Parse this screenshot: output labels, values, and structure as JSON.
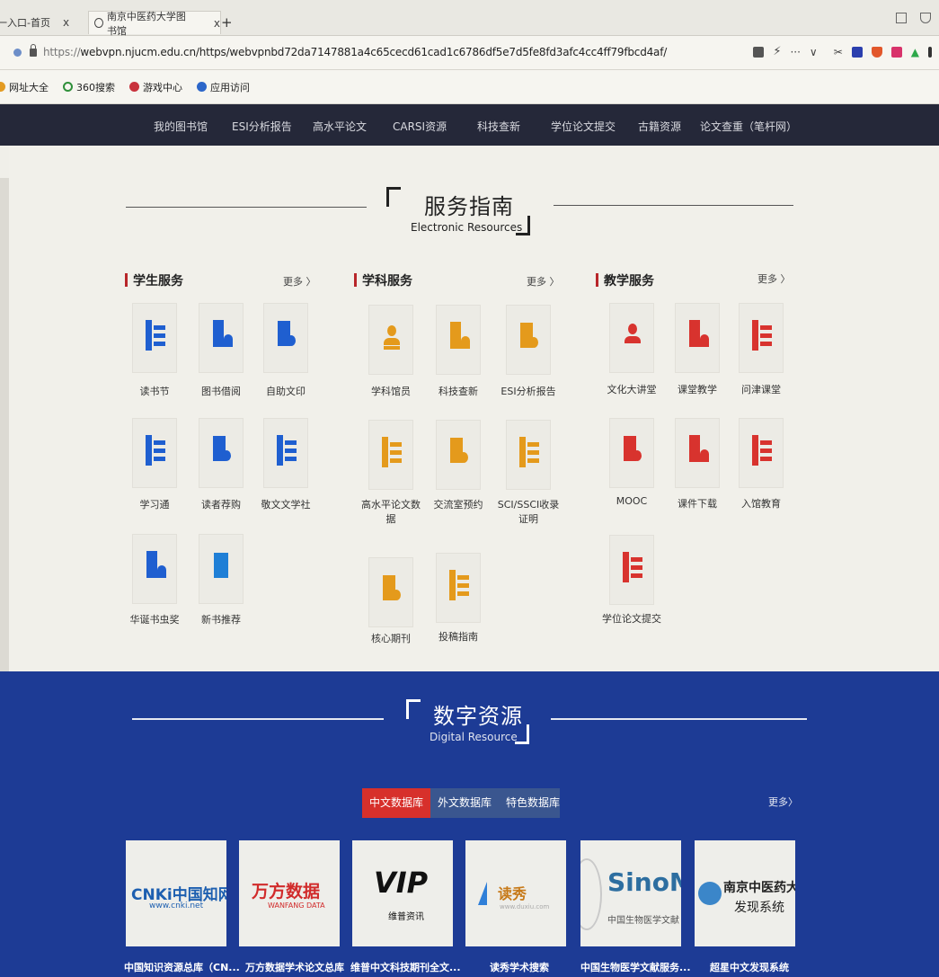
{
  "browser": {
    "tabs": [
      {
        "label": "统一入口-首页",
        "close": "x"
      },
      {
        "label": "南京中医药大学图书馆",
        "close": "x"
      }
    ],
    "new_tab": "+",
    "url_scheme": "https://",
    "url_rest": "webvpn.njucm.edu.cn/https/webvpnbd72da7147881a4c65cecd61cad1c6786df5e7d5fe8fd3afc4cc4ff79fbcd4af/",
    "bookmarks": [
      "网址大全",
      "360搜索",
      "游戏中心",
      "应用访问"
    ]
  },
  "site_nav": [
    "我的图书馆",
    "ESI分析报告",
    "高水平论文",
    "CARSI资源",
    "科技查新",
    "学位论文提交",
    "古籍资源",
    "论文查重（笔杆网）"
  ],
  "service_guide": {
    "title": "服务指南",
    "subtitle": "Electronic Resources",
    "more": "更多 〉",
    "columns": [
      {
        "title": "学生服务",
        "items": [
          "读书节",
          "图书借阅",
          "自助文印",
          "学习通",
          "读者荐购",
          "敬文文学社",
          "华诞书虫奖",
          "新书推荐"
        ]
      },
      {
        "title": "学科服务",
        "items": [
          "学科馆员",
          "科技查新",
          "ESI分析报告",
          "高水平论文数据",
          "交流室预约",
          "SCI/SSCI收录证明",
          "核心期刊",
          "投稿指南"
        ]
      },
      {
        "title": "教学服务",
        "items": [
          "文化大讲堂",
          "课堂教学",
          "问津课堂",
          "MOOC",
          "课件下载",
          "入馆教育",
          "学位论文提交"
        ]
      }
    ]
  },
  "digital": {
    "title": "数字资源",
    "subtitle": "Digital Resource",
    "tabs": [
      "中文数据库",
      "外文数据库",
      "特色数据库"
    ],
    "more": "更多〉",
    "cards": [
      {
        "label": "中国知识资源总库（CN...",
        "logo": "CNKi中国知网",
        "logo_sub": "www.cnki.net"
      },
      {
        "label": "万方数据学术论文总库",
        "logo": "万方数据",
        "logo_sub": "WANFANG DATA"
      },
      {
        "label": "维普中文科技期刊全文...",
        "logo": "VIP",
        "logo_sub": "维普资讯"
      },
      {
        "label": "读秀学术搜索",
        "logo": "读秀",
        "logo_sub": "www.duxiu.com"
      },
      {
        "label": "中国生物医学文献服务...",
        "logo": "SinoM",
        "logo_sub": "中国生物医学文献"
      },
      {
        "label": "超星中文发现系统",
        "logo": "南京中医药大",
        "logo_sub": "发现系统"
      }
    ]
  },
  "colors": {
    "blue_icon": "#1f5fd0",
    "orange_icon": "#e49a1c",
    "red_icon": "#d8332e",
    "nav_bg": "#252839",
    "digital_bg": "#1b3584",
    "tab_active": "#d7302b"
  }
}
